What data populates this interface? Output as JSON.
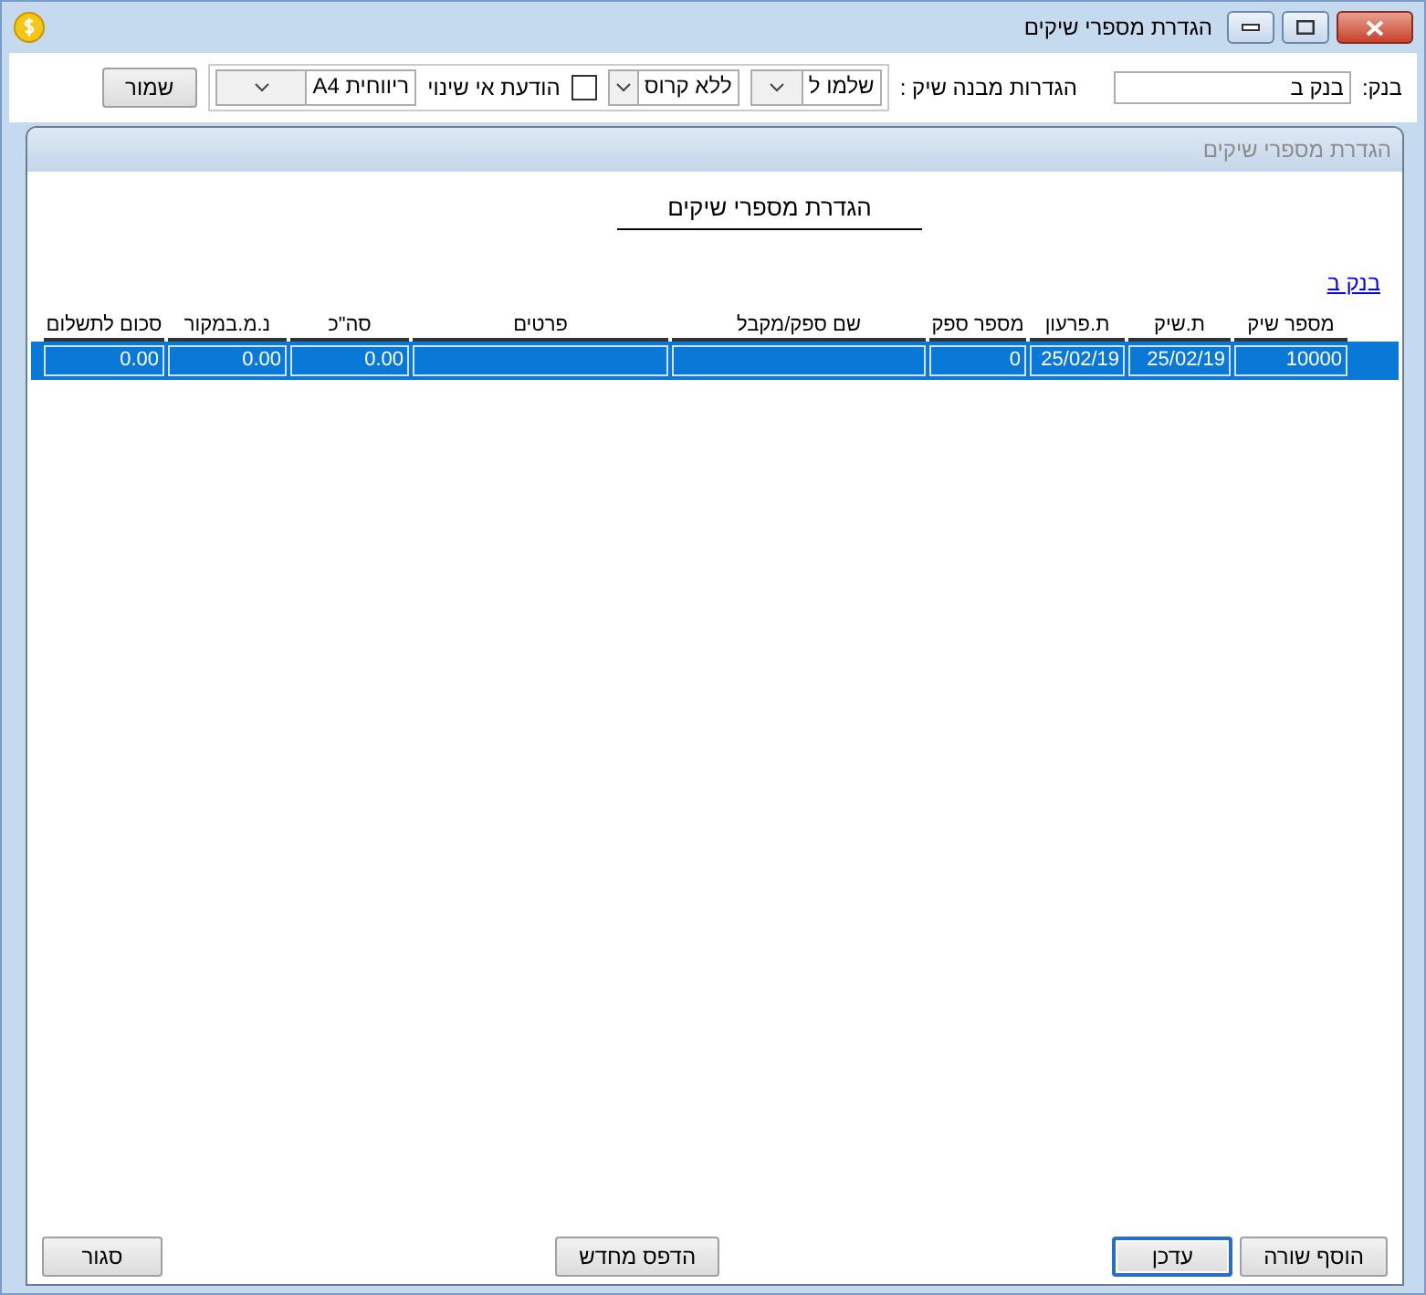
{
  "window": {
    "title": "הגדרת מספרי שיקים"
  },
  "toolbar": {
    "bank_label": "בנק:",
    "bank_value": "בנק ב",
    "structure_label": "הגדרות מבנה שיק :",
    "combos": [
      {
        "value": "שלמו ל"
      },
      {
        "value": "ללא קרוס"
      }
    ],
    "checkbox": {
      "label": "הודעת אי שינוי",
      "checked": false
    },
    "layout_combo": {
      "value": "ריווחית A4"
    },
    "save_button": "שמור"
  },
  "panel": {
    "title": "הגדרת מספרי שיקים",
    "report_title": "הגדרת מספרי שיקים",
    "bank_link": "בנק ב",
    "table": {
      "columns": [
        "מספר שיק",
        "ת.שיק",
        "ת.פרעון",
        "מספר ספק",
        "שם ספק/מקבל",
        "פרטים",
        "סה\"כ",
        "נ.מ.במקור",
        "סכום לתשלום"
      ],
      "rows": [
        {
          "selected": true,
          "cells": [
            "10000",
            "25/02/19",
            "25/02/19",
            "0",
            "",
            "",
            "0.00",
            "0.00",
            "0.00"
          ]
        }
      ]
    }
  },
  "buttons": [
    {
      "label": "הוסף שורה",
      "kind": "right",
      "focused": false
    },
    {
      "label": "עדכן",
      "kind": "right",
      "focused": true
    },
    {
      "label": "הדפס מחדש",
      "kind": "center",
      "focused": false
    },
    {
      "label": "סגור",
      "kind": "left",
      "focused": false
    }
  ]
}
